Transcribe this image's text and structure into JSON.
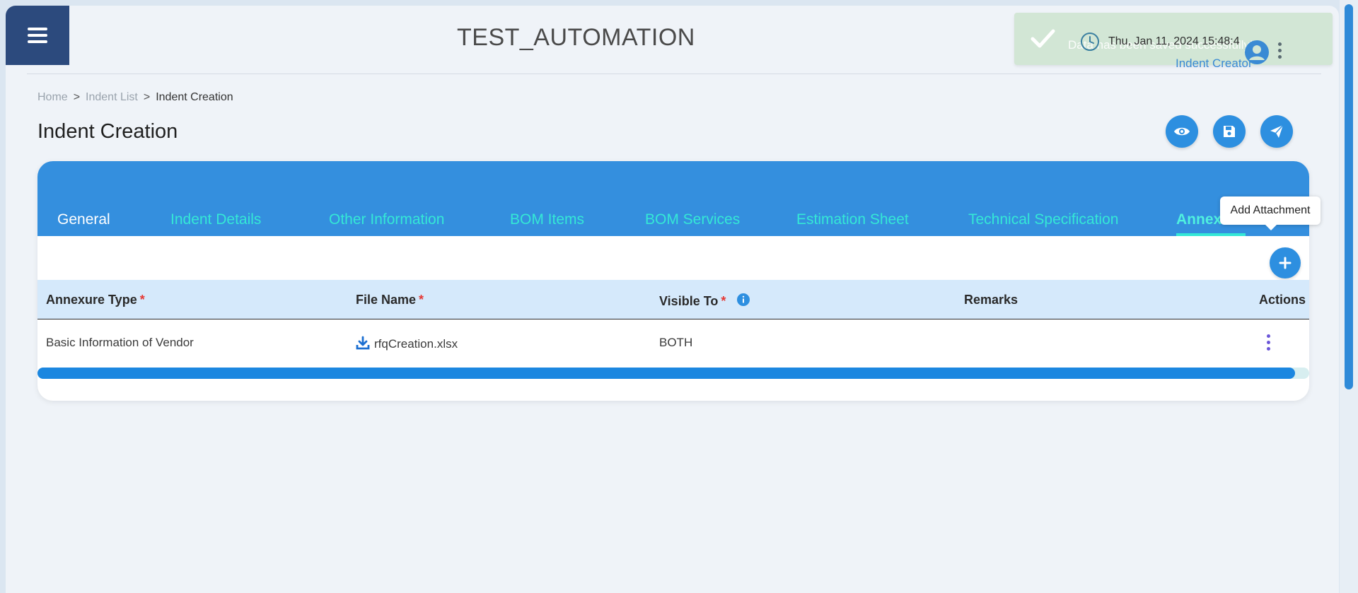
{
  "header": {
    "app_title": "TEST_AUTOMATION",
    "menu_icon": "hamburger-icon",
    "datetime": "Thu, Jan 11, 2024 15:48:4",
    "user_role": "Indent Creator",
    "avatar_icon": "user-circle-icon"
  },
  "toast": {
    "message": "Data has been saved successfully!",
    "icon": "check-icon",
    "background": "#d2e6d5"
  },
  "breadcrumb": {
    "items": [
      "Home",
      "Indent List",
      "Indent Creation"
    ],
    "separator": ">"
  },
  "page": {
    "title": "Indent Creation",
    "actions": [
      {
        "icon": "eye-icon",
        "label": "Preview"
      },
      {
        "icon": "save-icon",
        "label": "Save"
      },
      {
        "icon": "send-icon",
        "label": "Submit"
      }
    ]
  },
  "tabs": [
    {
      "label": "General",
      "state": "white"
    },
    {
      "label": "Indent Details"
    },
    {
      "label": "Other Information"
    },
    {
      "label": "BOM Items"
    },
    {
      "label": "BOM Services"
    },
    {
      "label": "Estimation Sheet"
    },
    {
      "label": "Technical Specification"
    },
    {
      "label": "Annexure",
      "state": "active"
    }
  ],
  "tooltip": {
    "text": "Add Attachment"
  },
  "table": {
    "columns": [
      {
        "label": "Annexure Type",
        "required": "*"
      },
      {
        "label": "File Name",
        "required": "*"
      },
      {
        "label": "Visible To",
        "required": "*"
      },
      {
        "label": "Remarks"
      },
      {
        "label": "Actions"
      }
    ],
    "rows": [
      {
        "annexure_type": "Basic Information of Vendor",
        "file_name": "rfqCreation.xlsx",
        "visible_to": "BOTH",
        "remarks": ""
      }
    ]
  },
  "colors": {
    "primary": "#2d8fe0",
    "tab_bar": "#348fde",
    "tab_text": "#34e8d6",
    "header_bg": "#d5e9fb",
    "menu_bg": "#2c4a7d",
    "required": "#e53935"
  }
}
